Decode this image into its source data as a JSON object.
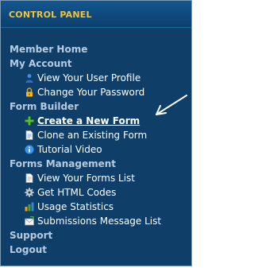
{
  "panel": {
    "title": "CONTROL PANEL"
  },
  "nav": {
    "member_home": "Member Home",
    "my_account": {
      "title": "My Account",
      "items": [
        {
          "label": "View Your User Profile",
          "icon": "user-icon"
        },
        {
          "label": "Change Your Password",
          "icon": "lock-icon"
        }
      ]
    },
    "form_builder": {
      "title": "Form Builder",
      "items": [
        {
          "label": "Create a New Form",
          "icon": "plus-icon",
          "active": true
        },
        {
          "label": "Clone an Existing Form",
          "icon": "document-icon"
        },
        {
          "label": "Tutorial Video",
          "icon": "info-icon"
        }
      ]
    },
    "forms_management": {
      "title": "Forms Management",
      "items": [
        {
          "label": "View Your Forms List",
          "icon": "document-icon"
        },
        {
          "label": "Get HTML Codes",
          "icon": "gear-icon"
        },
        {
          "label": "Usage Statistics",
          "icon": "bar-chart-icon"
        },
        {
          "label": "Submissions Message List",
          "icon": "envelope-icon"
        }
      ]
    },
    "support": "Support",
    "logout": "Logout"
  },
  "colors": {
    "panel_bg": "#0f3e68",
    "title": "#f4c23a",
    "section_text": "#b7cbe0",
    "item_text": "#ffffff"
  }
}
